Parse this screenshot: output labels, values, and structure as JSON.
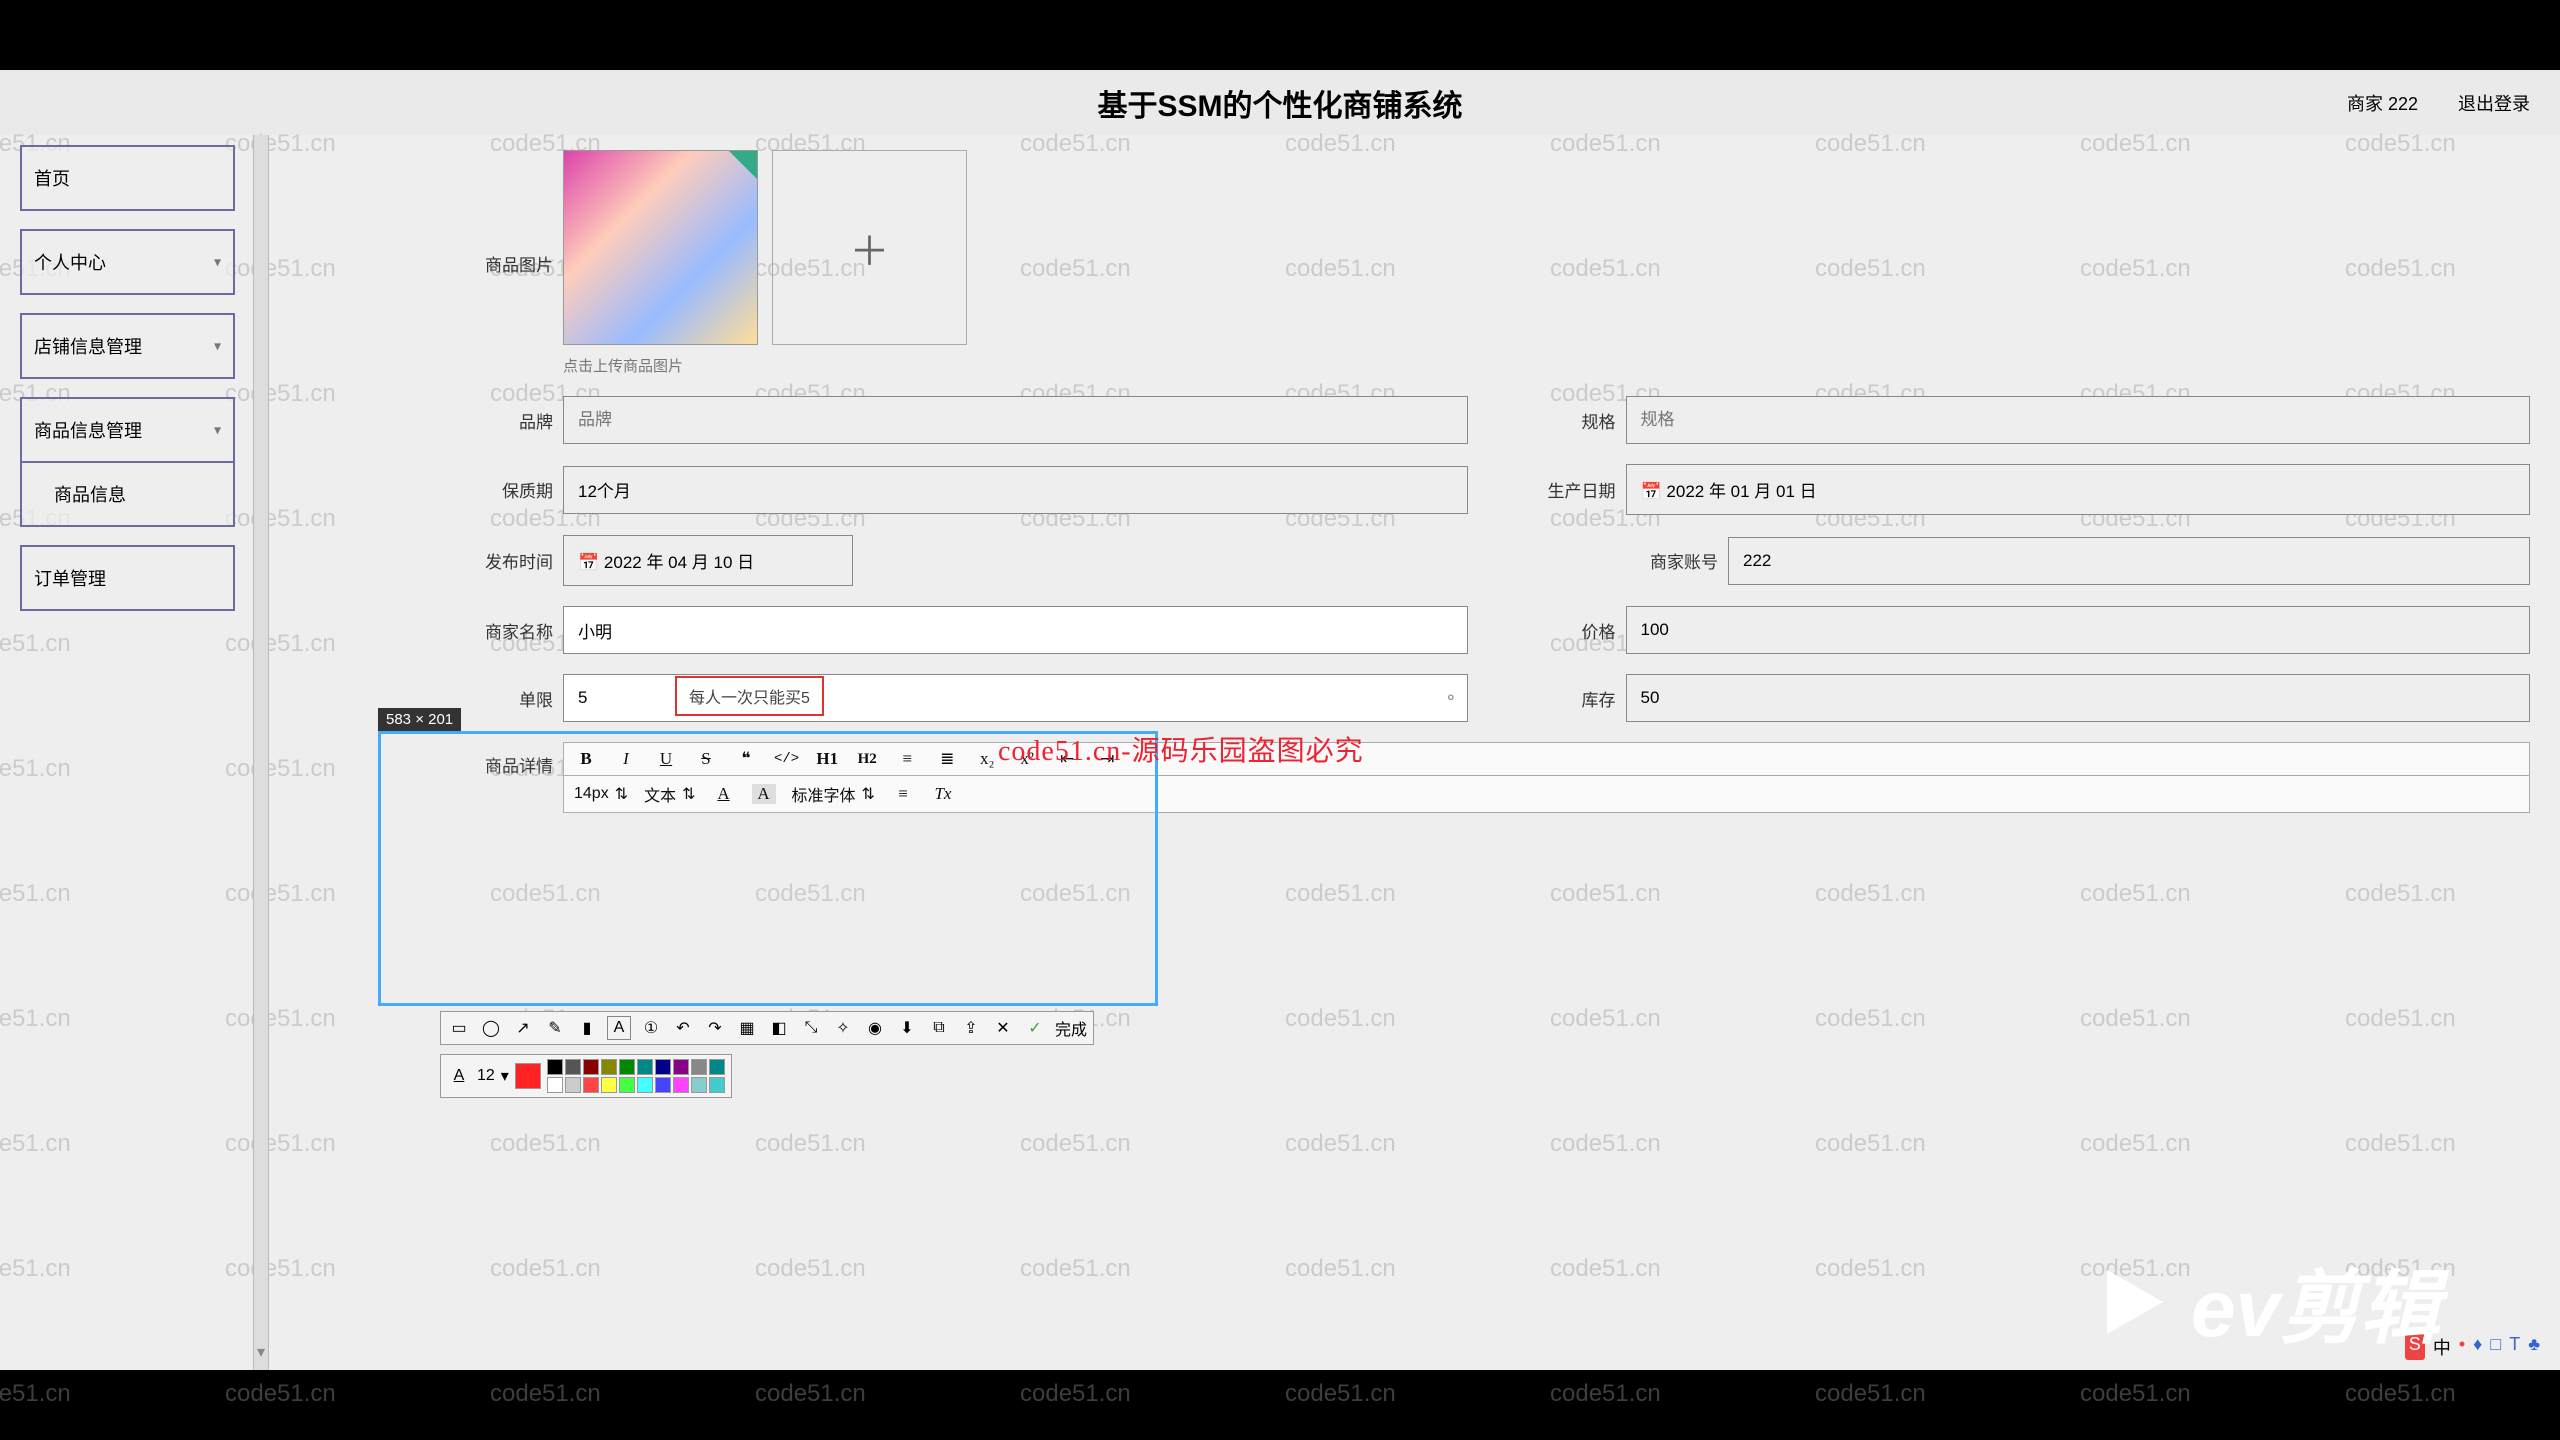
{
  "header": {
    "title": "基于SSM的个性化商铺系统",
    "merchant_label": "商家 222",
    "logout": "退出登录"
  },
  "sidebar": {
    "items": [
      {
        "label": "首页",
        "expandable": false
      },
      {
        "label": "个人中心",
        "expandable": true
      },
      {
        "label": "店铺信息管理",
        "expandable": true
      },
      {
        "label": "商品信息管理",
        "expandable": true
      },
      {
        "label": "商品信息",
        "expandable": false,
        "sub": true
      },
      {
        "label": "订单管理",
        "expandable": false
      }
    ]
  },
  "form": {
    "image_label": "商品图片",
    "upload_hint": "点击上传商品图片",
    "brand_label": "品牌",
    "brand_placeholder": "品牌",
    "spec_label": "规格",
    "spec_placeholder": "规格",
    "shelf_life_label": "保质期",
    "shelf_life_value": "12个月",
    "prod_date_label": "生产日期",
    "prod_date_value": "2022 年 01 月 01 日",
    "publish_label": "发布时间",
    "publish_value": "2022 年 04 月 10 日",
    "merchant_account_label": "商家账号",
    "merchant_account_value": "222",
    "merchant_name_label": "商家名称",
    "merchant_name_value": "小明",
    "price_label": "价格",
    "price_value": "100",
    "limit_label": "单限",
    "limit_value": "5",
    "limit_tooltip": "每人一次只能买5",
    "stock_label": "库存",
    "stock_value": "50",
    "detail_label": "商品详情"
  },
  "rte": {
    "font_size": "14px",
    "style_select": "文本",
    "font_family": "标准字体",
    "buttons": {
      "bold": "B",
      "italic": "I",
      "underline": "U",
      "strike": "S",
      "quote": "❝",
      "code": "</>",
      "h1": "H1",
      "h2": "H2",
      "ol": "≡",
      "ul": "≣",
      "sub": "x₂",
      "sup": "x²",
      "outdent": "⇤",
      "indent": "⇥",
      "color": "A",
      "bg": "A",
      "align": "≡",
      "clear": "Tx"
    }
  },
  "annotation": {
    "size_tag": "583 × 201",
    "done_label": "完成",
    "font_size_sel": "12"
  },
  "colors": {
    "palette": [
      "#000",
      "#555",
      "#800",
      "#880",
      "#080",
      "#088",
      "#008",
      "#808",
      "#888",
      "#088",
      "#fff",
      "#ccc",
      "#f44",
      "#ff4",
      "#4f4",
      "#4ff",
      "#44f",
      "#f4f",
      "#8cc",
      "#4cc"
    ],
    "selected": "#f22"
  },
  "watermarks": {
    "text": "code51.cn",
    "red_text": "code51.cn-源码乐园盗图必究"
  },
  "ev_logo": {
    "text": "ev剪辑"
  },
  "tray": {
    "items": [
      "中",
      "•",
      "♦",
      "□",
      "T",
      "♣"
    ]
  },
  "calendar_icon": "📅"
}
